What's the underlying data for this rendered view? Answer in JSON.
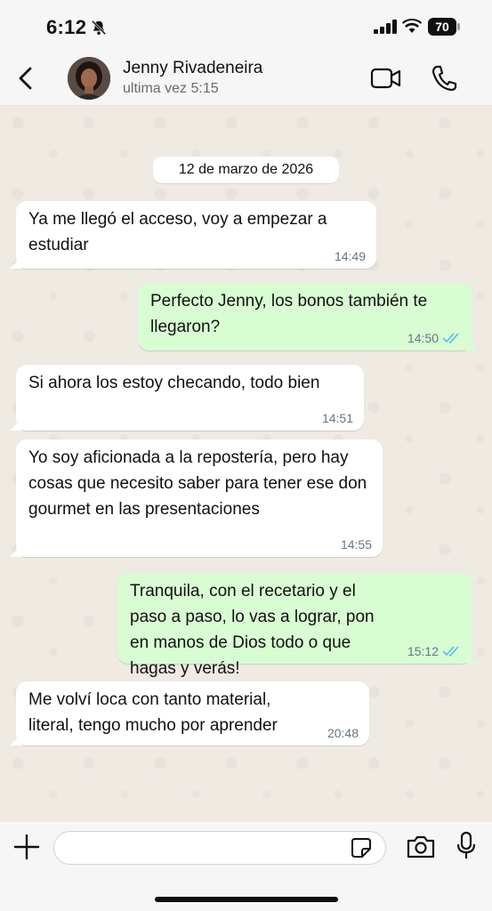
{
  "status_bar": {
    "time": "6:12",
    "battery": "70"
  },
  "header": {
    "contact_name": "Jenny Rivadeneira",
    "last_seen": "ultima vez 5:15"
  },
  "date_chip": "12 de marzo de 2026",
  "messages": [
    {
      "direction": "in",
      "text": "Ya me llegó el acceso, voy a empezar a estudiar",
      "time": "14:49"
    },
    {
      "direction": "out",
      "text": "Perfecto Jenny, los bonos también te llegaron?",
      "time": "14:50",
      "status": "read"
    },
    {
      "direction": "in",
      "text": "Si ahora los estoy checando, todo bien",
      "time": "14:51"
    },
    {
      "direction": "in",
      "text": "Yo soy aficionada a la repostería, pero hay cosas que necesito saber para tener ese don gourmet en las presentaciones",
      "time": "14:55"
    },
    {
      "direction": "out",
      "text": "Tranquila, con el recetario y el paso a paso, lo vas a lograr, pon en manos de Dios todo o que hagas y verás!",
      "time": "15:12",
      "status": "read"
    },
    {
      "direction": "in",
      "text": "Me volví loca con tanto material, literal, tengo mucho por aprender",
      "time": "20:48"
    }
  ],
  "composer": {
    "input_value": "",
    "placeholder": ""
  },
  "colors": {
    "incoming": "#ffffff",
    "outgoing": "#d9fdd3",
    "read_ticks": "#53bdeb",
    "wallpaper": "#efeae2"
  },
  "icons": [
    "bell-off-icon",
    "signal-icon",
    "wifi-icon",
    "back-chevron-icon",
    "video-call-icon",
    "phone-call-icon",
    "double-check-icon",
    "plus-icon",
    "sticker-icon",
    "camera-icon",
    "mic-icon"
  ]
}
